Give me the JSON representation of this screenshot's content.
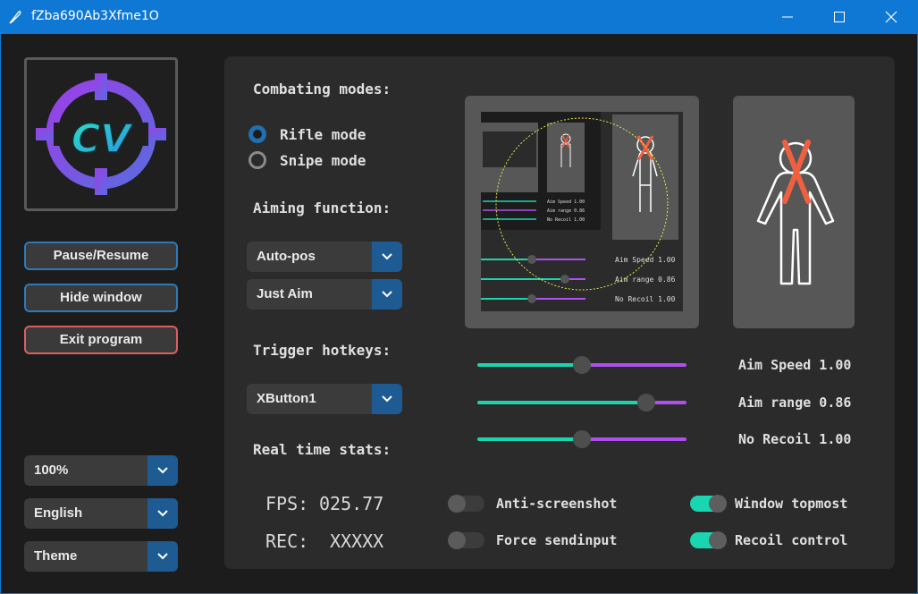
{
  "window": {
    "title": "fZba690Ab3Xfme1O",
    "controls": {
      "minimize_icon": "minimize-icon",
      "maximize_icon": "maximize-icon",
      "close_icon": "close-icon"
    }
  },
  "sidebar": {
    "logo_text": "CV",
    "buttons": {
      "pause": "Pause/Resume",
      "hide": "Hide window",
      "exit": "Exit program"
    },
    "zoom": "100%",
    "language": "English",
    "theme": "Theme"
  },
  "main": {
    "combat_heading": "Combating modes:",
    "modes": [
      {
        "label": "Rifle mode",
        "selected": true
      },
      {
        "label": "Snipe mode",
        "selected": false
      }
    ],
    "aiming_heading": "Aiming function:",
    "aim_position": "Auto-pos",
    "aim_type": "Just Aim",
    "hotkey_heading": "Trigger hotkeys:",
    "hotkey": "XButton1",
    "stats_heading": "Real time stats:",
    "fps_label": "FPS:",
    "fps_value": "025.77",
    "rec_label": "REC:",
    "rec_value": "XXXXX"
  },
  "sliders": [
    {
      "label": "Aim Speed 1.00",
      "value": 1.0,
      "min": 0,
      "max": 2
    },
    {
      "label": "Aim range 0.86",
      "value": 0.86,
      "min": 0,
      "max": 1.3
    },
    {
      "label": "No Recoil 1.00",
      "value": 1.0,
      "min": 0,
      "max": 2
    }
  ],
  "toggles": [
    {
      "label": "Anti-screenshot",
      "on": false
    },
    {
      "label": "Force sendinput",
      "on": false
    },
    {
      "label": "Window topmost",
      "on": true
    },
    {
      "label": "Recoil control",
      "on": true
    }
  ],
  "colors": {
    "titlebar": "#0f78d4",
    "accent_teal": "#1ad6b0",
    "accent_purple": "#b04ff0",
    "dropdown_arrow": "#1f5b93",
    "exit_border": "#d9605f",
    "target_x": "#f06040"
  }
}
